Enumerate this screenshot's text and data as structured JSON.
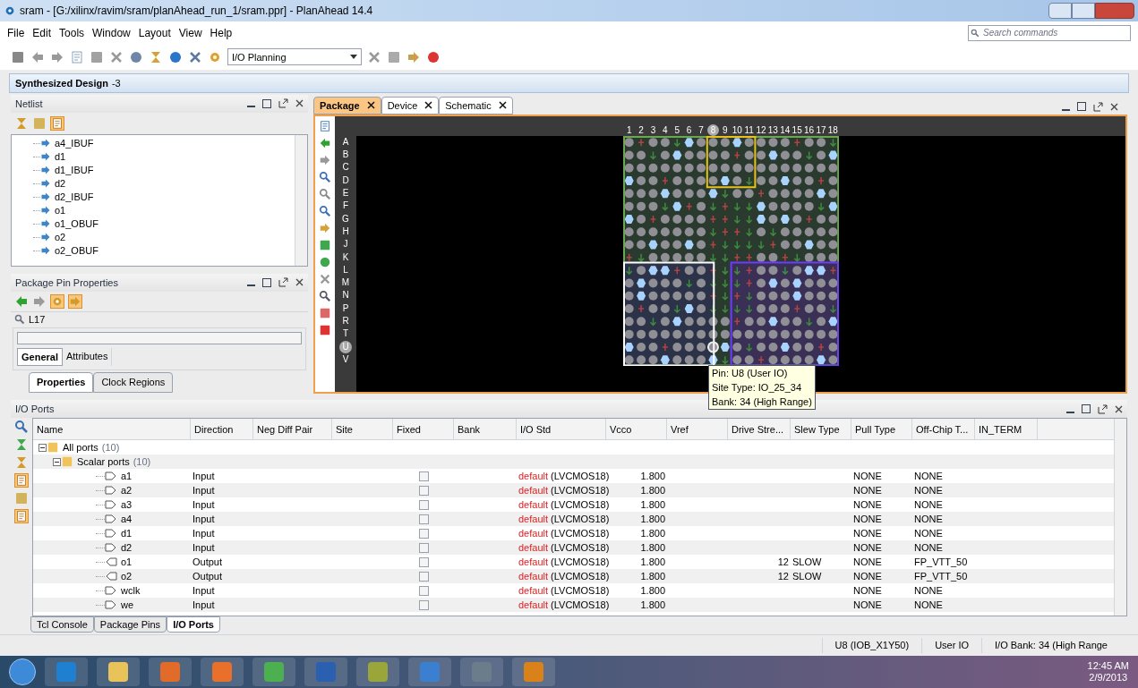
{
  "window": {
    "title": "sram - [G:/xilinx/ravim/sram/planAhead_run_1/sram.ppr] - PlanAhead 14.4"
  },
  "menu": [
    "File",
    "Edit",
    "Tools",
    "Window",
    "Layout",
    "View",
    "Help"
  ],
  "search": {
    "placeholder": "Search commands"
  },
  "toolbar": {
    "layout_select": "I/O Planning"
  },
  "design_bar": {
    "title": "Synthesized Design",
    "suffix": "-3"
  },
  "netlist": {
    "title": "Netlist",
    "items": [
      "a4_IBUF",
      "d1",
      "d1_IBUF",
      "d2",
      "d2_IBUF",
      "o1",
      "o1_OBUF",
      "o2",
      "o2_OBUF"
    ]
  },
  "pin_properties": {
    "title": "Package Pin Properties",
    "pin": "L17",
    "tabs": [
      {
        "label": "General",
        "selected": true
      },
      {
        "label": "Attributes",
        "selected": false
      }
    ]
  },
  "left_tabs": [
    {
      "label": "Properties",
      "selected": true
    },
    {
      "label": "Clock Regions",
      "selected": false
    }
  ],
  "editor_tabs": [
    {
      "label": "Package",
      "selected": true
    },
    {
      "label": "Device",
      "selected": false
    },
    {
      "label": "Schematic",
      "selected": false
    }
  ],
  "package": {
    "columns": [
      {
        "label": "1",
        "selected": false
      },
      {
        "label": "2",
        "selected": false
      },
      {
        "label": "3",
        "selected": false
      },
      {
        "label": "4",
        "selected": false
      },
      {
        "label": "5",
        "selected": false
      },
      {
        "label": "6",
        "selected": false
      },
      {
        "label": "7",
        "selected": false
      },
      {
        "label": "8",
        "selected": true
      },
      {
        "label": "9",
        "selected": false
      },
      {
        "label": "10",
        "selected": false
      },
      {
        "label": "11",
        "selected": false
      },
      {
        "label": "12",
        "selected": false
      },
      {
        "label": "13",
        "selected": false
      },
      {
        "label": "14",
        "selected": false
      },
      {
        "label": "15",
        "selected": false
      },
      {
        "label": "16",
        "selected": false
      },
      {
        "label": "17",
        "selected": false
      },
      {
        "label": "18",
        "selected": false
      }
    ],
    "rows": [
      {
        "label": "A",
        "selected": false
      },
      {
        "label": "B",
        "selected": false
      },
      {
        "label": "C",
        "selected": false
      },
      {
        "label": "D",
        "selected": false
      },
      {
        "label": "E",
        "selected": false
      },
      {
        "label": "F",
        "selected": false
      },
      {
        "label": "G",
        "selected": false
      },
      {
        "label": "H",
        "selected": false
      },
      {
        "label": "J",
        "selected": false
      },
      {
        "label": "K",
        "selected": false
      },
      {
        "label": "L",
        "selected": false
      },
      {
        "label": "M",
        "selected": false
      },
      {
        "label": "N",
        "selected": false
      },
      {
        "label": "P",
        "selected": false
      },
      {
        "label": "R",
        "selected": false
      },
      {
        "label": "T",
        "selected": false
      },
      {
        "label": "U",
        "selected": true
      },
      {
        "label": "V",
        "selected": false
      }
    ],
    "tooltip": [
      "Pin: U8 (User IO)",
      "Site Type: IO_25_34",
      "Bank: 34 (High Range)"
    ]
  },
  "io_ports": {
    "title": "I/O Ports",
    "columns": [
      "Name",
      "Direction",
      "Neg Diff Pair",
      "Site",
      "Fixed",
      "Bank",
      "I/O Std",
      "Vcco",
      "Vref",
      "Drive Stre...",
      "Slew Type",
      "Pull Type",
      "Off-Chip T...",
      "IN_TERM"
    ],
    "groups": [
      {
        "label": "All ports",
        "count": "(10)",
        "expanded": true
      },
      {
        "label": "Scalar ports",
        "count": "(10)",
        "expanded": true
      }
    ],
    "rows": [
      {
        "name": "a1",
        "kind": "input",
        "direction": "Input",
        "fixed": false,
        "iostd_default": "default",
        "iostd": "(LVCMOS18)",
        "vcco": "1.800",
        "drive": "",
        "slew": "",
        "pull": "NONE",
        "offchip": "NONE"
      },
      {
        "name": "a2",
        "kind": "input",
        "direction": "Input",
        "fixed": false,
        "iostd_default": "default",
        "iostd": "(LVCMOS18)",
        "vcco": "1.800",
        "drive": "",
        "slew": "",
        "pull": "NONE",
        "offchip": "NONE"
      },
      {
        "name": "a3",
        "kind": "input",
        "direction": "Input",
        "fixed": false,
        "iostd_default": "default",
        "iostd": "(LVCMOS18)",
        "vcco": "1.800",
        "drive": "",
        "slew": "",
        "pull": "NONE",
        "offchip": "NONE"
      },
      {
        "name": "a4",
        "kind": "input",
        "direction": "Input",
        "fixed": false,
        "iostd_default": "default",
        "iostd": "(LVCMOS18)",
        "vcco": "1.800",
        "drive": "",
        "slew": "",
        "pull": "NONE",
        "offchip": "NONE"
      },
      {
        "name": "d1",
        "kind": "input",
        "direction": "Input",
        "fixed": false,
        "iostd_default": "default",
        "iostd": "(LVCMOS18)",
        "vcco": "1.800",
        "drive": "",
        "slew": "",
        "pull": "NONE",
        "offchip": "NONE"
      },
      {
        "name": "d2",
        "kind": "input",
        "direction": "Input",
        "fixed": false,
        "iostd_default": "default",
        "iostd": "(LVCMOS18)",
        "vcco": "1.800",
        "drive": "",
        "slew": "",
        "pull": "NONE",
        "offchip": "NONE"
      },
      {
        "name": "o1",
        "kind": "output",
        "direction": "Output",
        "fixed": false,
        "iostd_default": "default",
        "iostd": "(LVCMOS18)",
        "vcco": "1.800",
        "drive": "12",
        "slew": "SLOW",
        "pull": "NONE",
        "offchip": "FP_VTT_50"
      },
      {
        "name": "o2",
        "kind": "output",
        "direction": "Output",
        "fixed": false,
        "iostd_default": "default",
        "iostd": "(LVCMOS18)",
        "vcco": "1.800",
        "drive": "12",
        "slew": "SLOW",
        "pull": "NONE",
        "offchip": "FP_VTT_50"
      },
      {
        "name": "wclk",
        "kind": "input",
        "direction": "Input",
        "fixed": false,
        "iostd_default": "default",
        "iostd": "(LVCMOS18)",
        "vcco": "1.800",
        "drive": "",
        "slew": "",
        "pull": "NONE",
        "offchip": "NONE"
      },
      {
        "name": "we",
        "kind": "input",
        "direction": "Input",
        "fixed": false,
        "iostd_default": "default",
        "iostd": "(LVCMOS18)",
        "vcco": "1.800",
        "drive": "",
        "slew": "",
        "pull": "NONE",
        "offchip": "NONE"
      }
    ]
  },
  "bottom_tabs": [
    {
      "label": "Tcl Console",
      "selected": false
    },
    {
      "label": "Package Pins",
      "selected": false
    },
    {
      "label": "I/O Ports",
      "selected": true
    }
  ],
  "status_bar": [
    "U8 (IOB_X1Y50)",
    "User IO",
    "I/O Bank: 34 (High Range"
  ],
  "taskbar": {
    "time": "12:45 AM",
    "date": "2/9/2013"
  }
}
